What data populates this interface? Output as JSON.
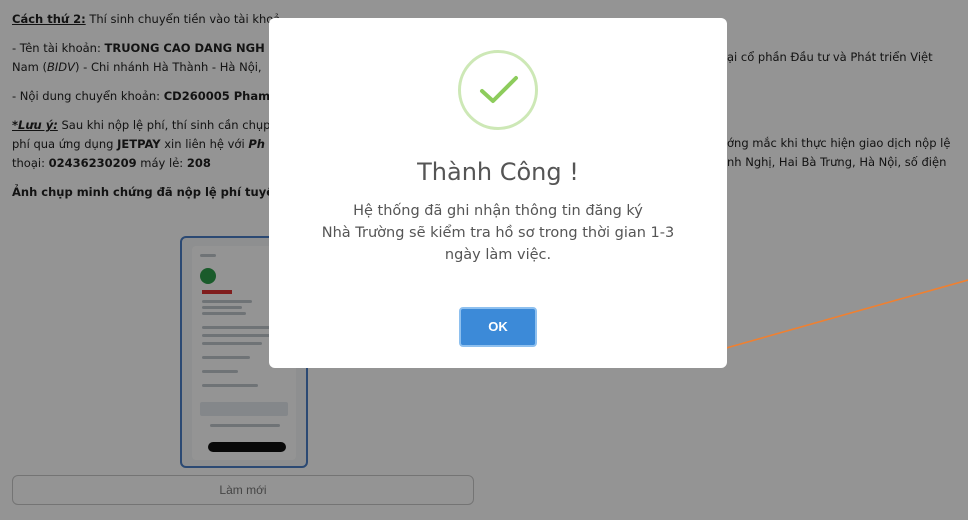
{
  "page": {
    "method2_label": "Cách thứ 2:",
    "method2_text": " Thí sinh chuyển tiền vào tài khoả",
    "account_prefix": "- Tên tài khoản: ",
    "account_name": "TRUONG CAO DANG NGH",
    "account_right": "ại cổ phần Đầu tư và Phát triển Việt",
    "bank_line_prefix": "Nam (",
    "bank_short": "BIDV",
    "bank_line_rest": ") - Chi nhánh Hà Thành - Hà Nội,",
    "content_prefix": "- Nội dung chuyển khoản: ",
    "content_value": "CD260005 Pham",
    "note_label": "*Lưu ý:",
    "note_text": " Sau khi nộp lệ phí, thí sinh cần chụp",
    "note_right1": "ớng mắc khi thực hiện giao dịch nộp lệ",
    "note_line2_prefix": "phí qua ứng dụng ",
    "note_app": "JETPAY",
    "note_line2_mid": " xin liên hệ với ",
    "note_line2_bold": "Ph",
    "note_right2": "nh Nghị, Hai Bà Trưng, Hà Nội, số điện",
    "phone_prefix": "thoại: ",
    "phone": "02436230209",
    "ext_label": " máy lẻ: ",
    "ext": "208",
    "proof_label": "Ảnh chụp minh chứng đã nộp lệ phí tuyển s",
    "refresh_button": "Làm mới"
  },
  "modal": {
    "icon": "success-check-icon",
    "title": "Thành Công !",
    "message_line1": "Hệ thống đã ghi nhận thông tin đăng ký",
    "message_line2": "Nhà Trường sẽ kiểm tra hồ sơ trong thời gian 1-3",
    "message_line3": "ngày làm việc.",
    "ok_button": "OK"
  },
  "colors": {
    "ok_button": "#3c8ad8",
    "check": "#8dcc5c",
    "annotation": "#f08030"
  }
}
